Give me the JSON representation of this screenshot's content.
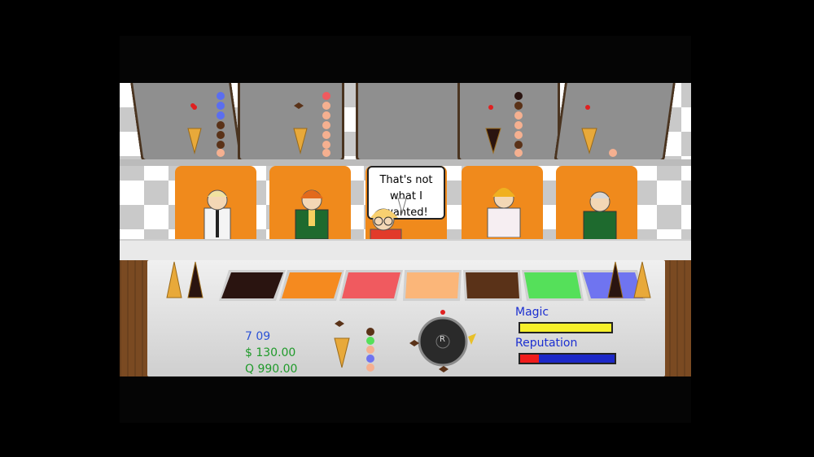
{
  "speech_bubble": {
    "lines": [
      "That's not",
      "what I",
      "wanted!"
    ]
  },
  "stats": {
    "time": "7 09",
    "money": "$ 130.00",
    "quota": "Q 990.00"
  },
  "meters": {
    "magic_label": "Magic",
    "magic_level": 1.0,
    "reputation_label": "Reputation",
    "reputation_level": 0.2
  },
  "dial": {
    "label": "R"
  },
  "flavors": [
    {
      "name": "chocolate",
      "color": "#2a1410"
    },
    {
      "name": "orange",
      "color": "#f58a1f"
    },
    {
      "name": "strawberry",
      "color": "#f05a5f"
    },
    {
      "name": "peach",
      "color": "#fbb679"
    },
    {
      "name": "mocha",
      "color": "#5a3218"
    },
    {
      "name": "lime",
      "color": "#55e05a"
    },
    {
      "name": "blueberry",
      "color": "#6f74f0"
    }
  ],
  "colors": {
    "time_text": "#2b52d6",
    "money_text": "#1f9a2a",
    "quota_text": "#1f9a2a",
    "magic_fill": "#f5ef2a",
    "reputation_fill": "#f01c1c",
    "reputation_empty": "#1c28c8",
    "chair": "#f08a1c"
  }
}
